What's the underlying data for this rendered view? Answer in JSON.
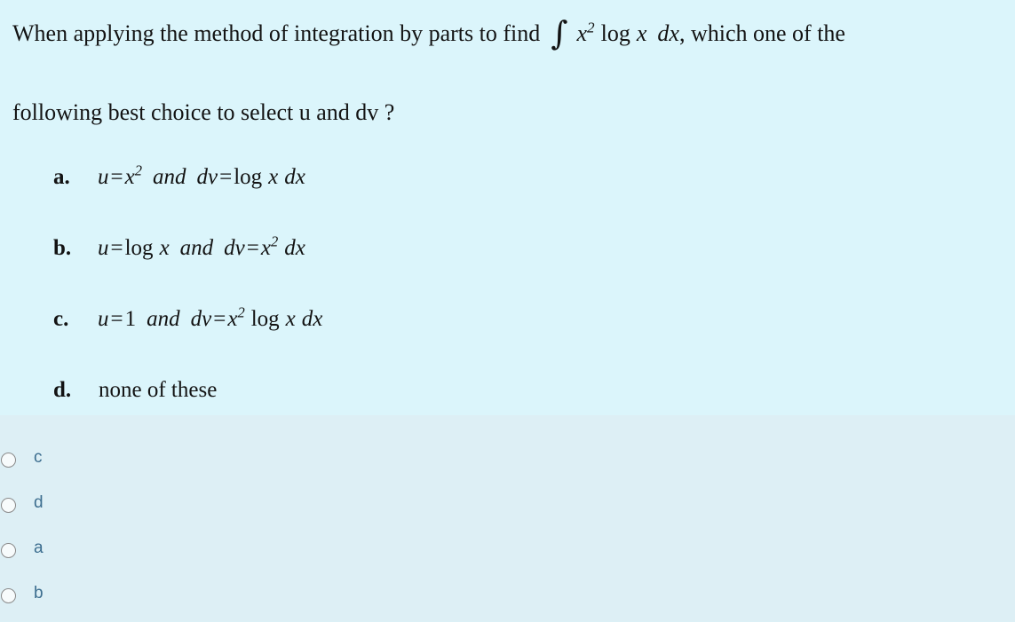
{
  "colors": {
    "question_background": "#dbf5fb",
    "answer_background": "#ddeff5",
    "text": "#131313",
    "radio_label": "#3d6e8f",
    "radio_border": "#8a8a8a"
  },
  "question": {
    "line1_part1": "When applying the method of integration by parts to find",
    "integral_sign": "∫",
    "integrand_base": "x",
    "integrand_exponent": "2",
    "integrand_log": "log",
    "integrand_var": "x",
    "integrand_differential": "dx",
    "line1_part2": ", which one of the",
    "line2": "following best choice to select u and dv ?"
  },
  "choices": [
    {
      "letter": "a.",
      "u_name": "u",
      "equals": "=",
      "u_value_base": "x",
      "u_value_exponent": "2",
      "conjunction": "and",
      "dv_name": "dv",
      "dv_equals": "=",
      "dv_value_log": "log",
      "dv_value_var": "x",
      "dv_value_differential": "dx"
    },
    {
      "letter": "b.",
      "u_name": "u",
      "equals": "=",
      "u_value_log": "log",
      "u_value_var": "x",
      "conjunction": "and",
      "dv_name": "dv",
      "dv_equals": "=",
      "dv_value_base": "x",
      "dv_value_exponent": "2",
      "dv_value_differential": "dx"
    },
    {
      "letter": "c.",
      "u_name": "u",
      "equals": "=",
      "u_value": "1",
      "conjunction": "and",
      "dv_name": "dv",
      "dv_equals": "=",
      "dv_value_base": "x",
      "dv_value_exponent": "2",
      "dv_value_log": "log",
      "dv_value_var": "x",
      "dv_value_differential": "dx"
    },
    {
      "letter": "d.",
      "text": "none of these"
    }
  ],
  "answer_options": [
    {
      "label": "c",
      "selected": false
    },
    {
      "label": "d",
      "selected": false
    },
    {
      "label": "a",
      "selected": false
    },
    {
      "label": "b",
      "selected": false
    }
  ]
}
